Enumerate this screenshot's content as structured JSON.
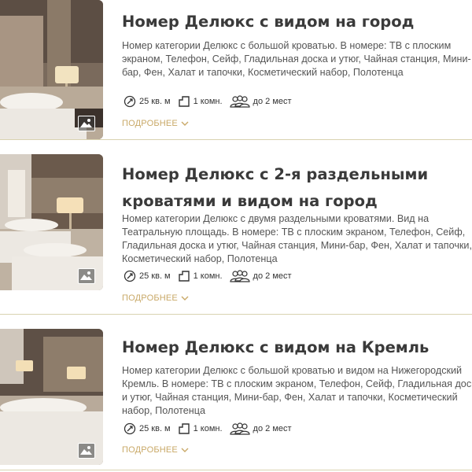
{
  "rooms": [
    {
      "title": "Номер Делюкс с видом на город",
      "description": "Номер категории Делюкс с большой кроватью. В номере: ТВ с плоским экраном, Телефон, Сейф, Гладильная доска и утюг, Чайная станция, Мини-бар, Фен, Халат и тапочки, Косметический набор, Полотенца",
      "area": "25 кв. м",
      "rooms_count": "1 комн.",
      "guests": "до 2 мест",
      "more_label": "ПОДРОБНЕЕ",
      "photo_icon": "image-gallery-icon"
    },
    {
      "title": "Номер Делюкс с 2-я раздельными кроватями и видом на город",
      "description": "Номер категории Делюкс с двумя раздельными кроватями. Вид на Театральную площадь. В номере: ТВ с плоским экраном, Телефон, Сейф, Гладильная доска и утюг, Чайная станция, Мини-бар, Фен, Халат и тапочки, Косметический набор, Полотенца",
      "area": "25 кв. м",
      "rooms_count": "1 комн.",
      "guests": "до 2 мест",
      "more_label": "ПОДРОБНЕЕ",
      "photo_icon": "image-gallery-icon"
    },
    {
      "title": "Номер Делюкс с видом на Кремль",
      "description": "Номер категории Делюкс с большой кроватью и видом на Нижегородский Кремль. В номере: ТВ с плоским экраном, Телефон, Сейф, Гладильная доска и утюг, Чайная станция, Мини-бар, Фен, Халат и тапочки, Косметический набор, Полотенца",
      "area": "25 кв. м",
      "rooms_count": "1 комн.",
      "guests": "до 2 мест",
      "more_label": "ПОДРОБНЕЕ",
      "photo_icon": "image-gallery-icon"
    }
  ],
  "colors": {
    "accent": "#c9a968",
    "divider": "#d9d2b0",
    "title": "#3a3a3a"
  }
}
